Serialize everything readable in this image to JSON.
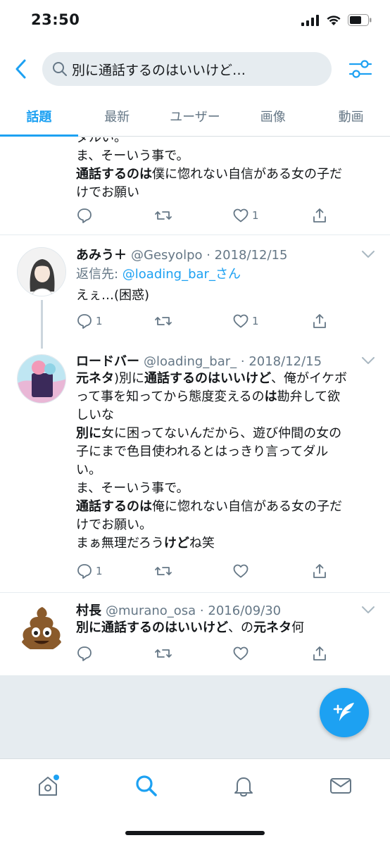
{
  "status": {
    "time": "23:50"
  },
  "search": {
    "query": "別に通話するのはいいけど…"
  },
  "tabs": [
    {
      "label": "話題"
    },
    {
      "label": "最新"
    },
    {
      "label": "ユーザー"
    },
    {
      "label": "画像"
    },
    {
      "label": "動画"
    }
  ],
  "tweet0": {
    "line_cut": "ダルい。",
    "line1": "ま、そーいう事で。",
    "line2_bold": "通話するのは",
    "line2_rest": "僕に惚れない自信がある女の子だ",
    "line3": "けでお願い",
    "likes": "1"
  },
  "tweet1": {
    "name": "あみう＋",
    "meta": "@Gesyolpo · 2018/12/15",
    "reply_prefix": "返信先: ",
    "reply_handle": "@loading_bar_さん",
    "text": "えぇ…(困惑)",
    "replies": "1",
    "likes": "1"
  },
  "tweet2": {
    "name": "ロードバー",
    "meta": "@loading_bar_ · 2018/12/15",
    "l1_a": "元ネタ",
    "l1_b": ")別に",
    "l1_c": "通話するのはいいけど",
    "l1_d": "、俺がイケボ",
    "l2_a": "って事を知ってから態度変えるの",
    "l2_b": "は",
    "l2_c": "勘弁して欲",
    "l3": "しいな",
    "l4_a": "別に",
    "l4_b": "女に困ってないんだから、遊び仲間の女の",
    "l5": "子にまで色目使われるとはっきり言ってダル",
    "l6": "い。",
    "l7": "ま、そーいう事で。",
    "l8_a": "通話するのは",
    "l8_b": "俺に惚れない自信がある女の子だ",
    "l9": "けでお願い。",
    "l10_a": "まぁ無理だろう",
    "l10_b": "けど",
    "l10_c": "ね笑",
    "replies": "1"
  },
  "tweet3": {
    "name": "村長",
    "meta": "@murano_osa · 2016/09/30",
    "t_a": "別に通話するのはいいけど",
    "t_b": "、の",
    "t_c": "元ネタ",
    "t_d": "何"
  },
  "colors": {
    "accent": "#1da1f2",
    "secondary_text": "#657786",
    "background_gray": "#e6ecf0"
  }
}
